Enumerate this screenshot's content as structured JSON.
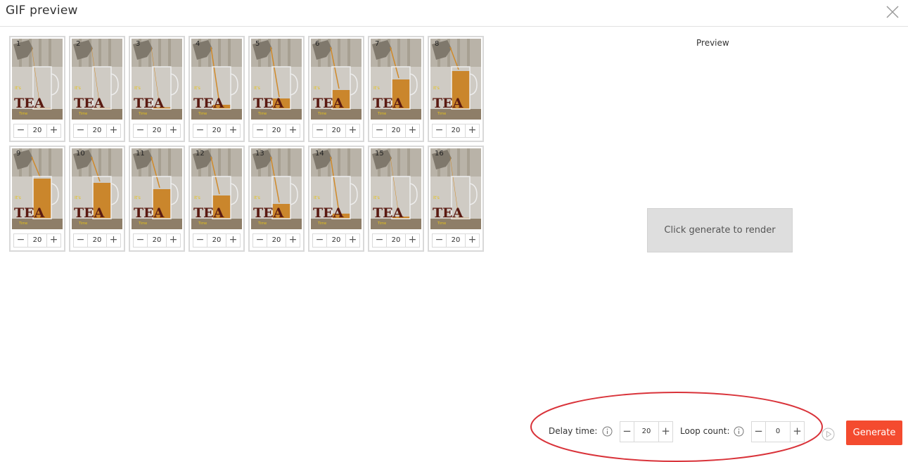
{
  "header": {
    "title": "GIF preview"
  },
  "frames": [
    {
      "num": "1",
      "delay": "20",
      "fill": 0.02
    },
    {
      "num": "2",
      "delay": "20",
      "fill": 0.02
    },
    {
      "num": "3",
      "delay": "20",
      "fill": 0.04
    },
    {
      "num": "4",
      "delay": "20",
      "fill": 0.1
    },
    {
      "num": "5",
      "delay": "20",
      "fill": 0.25
    },
    {
      "num": "6",
      "delay": "20",
      "fill": 0.45
    },
    {
      "num": "7",
      "delay": "20",
      "fill": 0.7
    },
    {
      "num": "8",
      "delay": "20",
      "fill": 0.9
    },
    {
      "num": "9",
      "delay": "20",
      "fill": 0.95
    },
    {
      "num": "10",
      "delay": "20",
      "fill": 0.85
    },
    {
      "num": "11",
      "delay": "20",
      "fill": 0.7
    },
    {
      "num": "12",
      "delay": "20",
      "fill": 0.55
    },
    {
      "num": "13",
      "delay": "20",
      "fill": 0.35
    },
    {
      "num": "14",
      "delay": "20",
      "fill": 0.12
    },
    {
      "num": "15",
      "delay": "20",
      "fill": 0.05
    },
    {
      "num": "16",
      "delay": "20",
      "fill": 0.02
    }
  ],
  "preview": {
    "label": "Preview",
    "placeholder": "Click generate to render"
  },
  "controls": {
    "delay_label": "Delay time:",
    "delay_value": "20",
    "loop_label": "Loop count:",
    "loop_value": "0",
    "generate_label": "Generate"
  },
  "icons": {
    "close": "close-icon",
    "info": "info-icon",
    "play": "play-icon",
    "minus": "minus-icon",
    "plus": "plus-icon"
  },
  "colors": {
    "accent": "#f44b2f",
    "highlight": "#d9333a",
    "tea": "#c97e1c",
    "logo_text": "#5a1a12"
  }
}
